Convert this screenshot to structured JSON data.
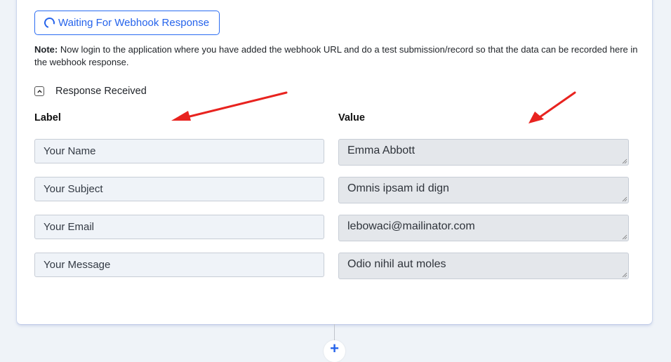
{
  "wait_button": {
    "label": "Waiting For Webhook Response",
    "icon": "loading-spinner-icon"
  },
  "note": {
    "prefix": "Note:",
    "text": " Now login to the application where you have added the webhook URL and do a test submission/record so that the data can be recorded here in the webhook response."
  },
  "response": {
    "toggle_label": "Response Received",
    "icon": "chevron-up-icon"
  },
  "columns": {
    "label": "Label",
    "value": "Value"
  },
  "rows": [
    {
      "label": "Your Name",
      "value": "Emma Abbott"
    },
    {
      "label": "Your Subject",
      "value": "Omnis ipsam id dign"
    },
    {
      "label": "Your Email",
      "value": "lebowaci@mailinator.com"
    },
    {
      "label": "Your Message",
      "value": "Odio nihil aut moles"
    }
  ],
  "add_step": {
    "label": "+",
    "icon": "plus-icon"
  },
  "colors": {
    "accent": "#2563eb",
    "annotation_arrow": "#e8231f"
  }
}
